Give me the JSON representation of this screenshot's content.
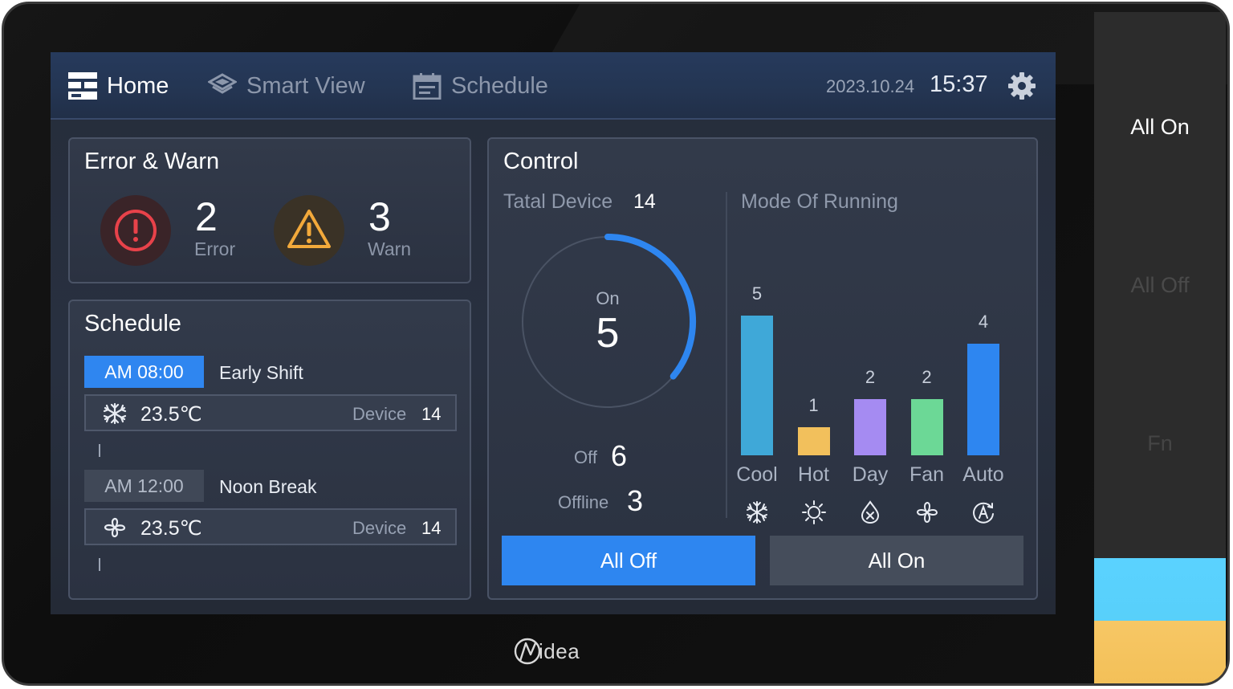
{
  "nav": {
    "home": "Home",
    "smart_view": "Smart View",
    "schedule": "Schedule",
    "date": "2023.10.24",
    "time": "15:37"
  },
  "error_warn": {
    "title": "Error & Warn",
    "error_count": "2",
    "error_label": "Error",
    "warn_count": "3",
    "warn_label": "Warn"
  },
  "schedule": {
    "title": "Schedule",
    "items": [
      {
        "time": "AM  08:00",
        "name": "Early Shift",
        "temp": "23.5℃",
        "device_label": "Device",
        "device_count": "14",
        "mode_icon": "snowflake-icon",
        "active": true
      },
      {
        "time": "AM  12:00",
        "name": "Noon Break",
        "temp": "23.5℃",
        "device_label": "Device",
        "device_count": "14",
        "mode_icon": "fan-icon",
        "active": false
      }
    ]
  },
  "control": {
    "title": "Control",
    "total_label": "Tatal Device",
    "total_value": "14",
    "on_label": "On",
    "on_value": "5",
    "off_label": "Off",
    "off_value": "6",
    "offline_label": "Offline",
    "offline_value": "3",
    "mode_title": "Mode Of Running",
    "all_off": "All Off",
    "all_on": "All On"
  },
  "chart_data": {
    "type": "bar",
    "title": "Mode Of Running",
    "categories": [
      "Cool",
      "Hot",
      "Day",
      "Fan",
      "Auto"
    ],
    "values": [
      5,
      1,
      2,
      2,
      4
    ],
    "colors": [
      "#3fa8d8",
      "#f2c05c",
      "#a58bf2",
      "#6cd896",
      "#2e86f0"
    ],
    "icons": [
      "snowflake-icon",
      "sun-icon",
      "drop-icon",
      "fan-icon",
      "auto-icon"
    ],
    "ylim": [
      0,
      5
    ]
  },
  "ring": {
    "on_fraction": 0.36,
    "accent": "#2e86f0"
  },
  "side": {
    "all_on": "All On",
    "all_off": "All Off",
    "fn": "Fn"
  },
  "brand": {
    "name": "idea"
  }
}
